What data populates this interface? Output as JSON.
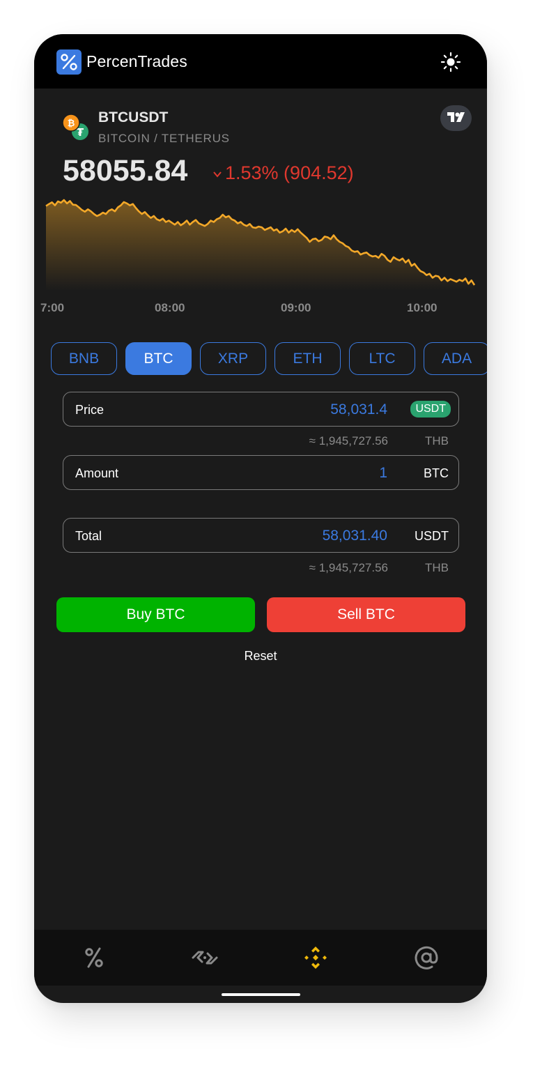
{
  "app": {
    "name": "PercenTrades"
  },
  "icons": {
    "logo": "percent-logo-icon",
    "theme": "sun-icon",
    "tradingview": "tradingview-icon",
    "coins": [
      "bitcoin-icon",
      "tether-icon"
    ],
    "nav": [
      "percent-icon",
      "handshake-icon",
      "binance-icon",
      "at-sign-icon"
    ]
  },
  "colors": {
    "accent": "#3b7ae0",
    "down": "#e0382e",
    "chart_line": "#f3a829",
    "buy": "#00b300",
    "sell": "#ee4036",
    "usdt_badge": "#2aa36f",
    "nav_active": "#f0b90b"
  },
  "market": {
    "symbol": "BTCUSDT",
    "pair_name": "BITCOIN / TETHERUS",
    "price": "58055.84",
    "change": "1.53% (904.52)",
    "direction": "down"
  },
  "chart_data": {
    "type": "area",
    "x_ticks": [
      "7:00",
      "08:00",
      "09:00",
      "10:00"
    ],
    "y": [
      58980,
      59010,
      59035,
      58990,
      59050,
      59030,
      59070,
      59020,
      59055,
      59000,
      58995,
      58960,
      58920,
      58895,
      58930,
      58900,
      58860,
      58830,
      58850,
      58880,
      58860,
      58910,
      58930,
      58900,
      58960,
      58990,
      59040,
      59020,
      58990,
      59010,
      58950,
      58900,
      58860,
      58890,
      58840,
      58800,
      58830,
      58780,
      58760,
      58790,
      58740,
      58760,
      58730,
      58700,
      58740,
      58690,
      58720,
      58760,
      58700,
      58740,
      58770,
      58720,
      58700,
      58680,
      58710,
      58760,
      58740,
      58780,
      58800,
      58850,
      58810,
      58830,
      58780,
      58760,
      58720,
      58740,
      58700,
      58680,
      58710,
      58660,
      58650,
      58670,
      58660,
      58620,
      58640,
      58660,
      58610,
      58630,
      58580,
      58600,
      58640,
      58580,
      58620,
      58590,
      58630,
      58580,
      58540,
      58500,
      58440,
      58480,
      58490,
      58450,
      58470,
      58520,
      58510,
      58480,
      58540,
      58480,
      58440,
      58420,
      58380,
      58360,
      58310,
      58290,
      58300,
      58250,
      58270,
      58280,
      58240,
      58220,
      58230,
      58200,
      58260,
      58230,
      58170,
      58140,
      58210,
      58180,
      58160,
      58190,
      58130,
      58170,
      58080,
      58110,
      58050,
      58000,
      57980,
      57940,
      57960,
      57900,
      57930,
      57920,
      57860,
      57900,
      57850,
      57880,
      57860,
      57840,
      57870,
      57850,
      57890,
      57810,
      57860,
      57790
    ]
  },
  "coin_tabs": [
    {
      "label": "BNB",
      "active": false
    },
    {
      "label": "BTC",
      "active": true
    },
    {
      "label": "XRP",
      "active": false
    },
    {
      "label": "ETH",
      "active": false
    },
    {
      "label": "LTC",
      "active": false
    },
    {
      "label": "ADA",
      "active": false
    }
  ],
  "form": {
    "price": {
      "label": "Price",
      "value": "58,031.4",
      "unit": "USDT",
      "approx": "≈ 1,945,727.56",
      "approx_unit": "THB"
    },
    "amount": {
      "label": "Amount",
      "value": "1",
      "unit": "BTC"
    },
    "total": {
      "label": "Total",
      "value": "58,031.40",
      "unit": "USDT",
      "approx": "≈ 1,945,727.56",
      "approx_unit": "THB"
    }
  },
  "actions": {
    "buy": "Buy BTC",
    "sell": "Sell BTC",
    "reset": "Reset"
  },
  "nav": {
    "active_index": 2
  }
}
